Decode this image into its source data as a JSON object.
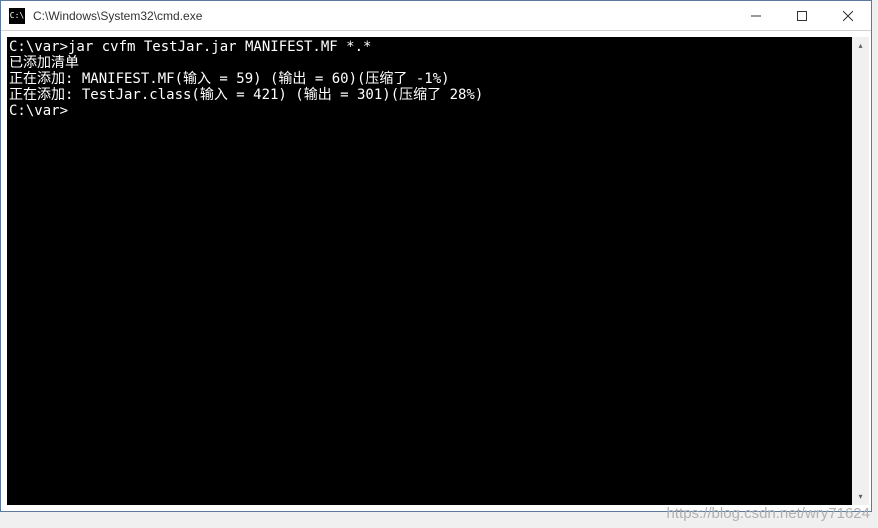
{
  "window": {
    "title": "C:\\Windows\\System32\\cmd.exe",
    "icon_label": "C:\\"
  },
  "terminal": {
    "lines": [
      "",
      "C:\\var>jar cvfm TestJar.jar MANIFEST.MF *.*",
      "已添加清单",
      "正在添加: MANIFEST.MF(输入 = 59) (输出 = 60)(压缩了 -1%)",
      "正在添加: TestJar.class(输入 = 421) (输出 = 301)(压缩了 28%)",
      "",
      "C:\\var>"
    ]
  },
  "controls": {
    "minimize": "minimize",
    "maximize": "maximize",
    "close": "close"
  },
  "watermark": "https://blog.csdn.net/wry71624"
}
